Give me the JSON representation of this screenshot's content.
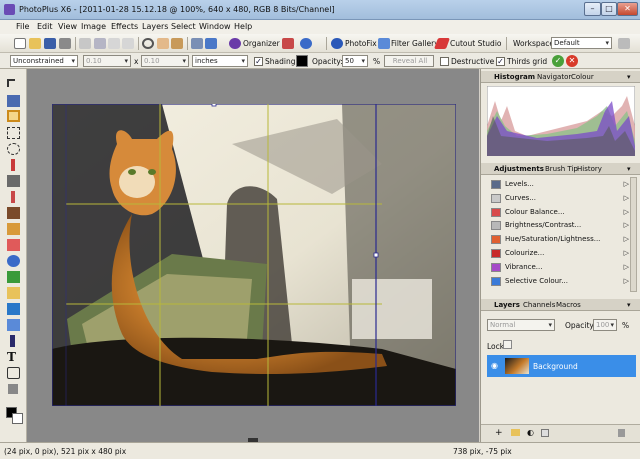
{
  "window": {
    "title": "PhotoPlus X6 - [2011-01-28 15.12.18 @ 100%, 640 x 480, RGB 8 Bits/Channel]",
    "buttons": [
      "–",
      "□",
      "✕"
    ]
  },
  "menu": [
    "File",
    "Edit",
    "View",
    "Image",
    "Effects",
    "Layers",
    "Select",
    "Window",
    "Help"
  ],
  "toolbar": {
    "organizer": "Organizer",
    "photofix": "PhotoFix",
    "filter_gallery": "Filter Gallery",
    "cutout_studio": "Cutout Studio",
    "workspace_label": "Workspace",
    "workspace_value": "Default"
  },
  "context_bar": {
    "crop_mode": "Unconstrained",
    "width": "0.10",
    "x_sep": "x",
    "height": "0.10",
    "units": "inches",
    "shading_label": "Shading",
    "shading_color": "#000000",
    "opacity_label": "Opacity:",
    "opacity_value": "50",
    "opacity_unit": "%",
    "reveal_all": "Reveal All",
    "destructive_label": "Destructive",
    "thirds_grid_label": "Thirds grid"
  },
  "panels": {
    "top_tabs": [
      "Histogram",
      "Navigator",
      "Colour"
    ],
    "adjust_tabs": [
      "Adjustments",
      "Brush Tip",
      "History"
    ],
    "adjustments": [
      {
        "label": "Levels...",
        "icon": "levels-icon",
        "color": "#5a6a8a"
      },
      {
        "label": "Curves...",
        "icon": "curves-icon",
        "color": "#c9c9c9"
      },
      {
        "label": "Colour Balance...",
        "icon": "colour-balance-icon",
        "color": "#d84b4b"
      },
      {
        "label": "Brightness/Contrast...",
        "icon": "brightness-contrast-icon",
        "color": "#b8b8b8"
      },
      {
        "label": "Hue/Saturation/Lightness...",
        "icon": "hue-saturation-icon",
        "color": "#e06030"
      },
      {
        "label": "Colourize...",
        "icon": "colourize-icon",
        "color": "#c82a2a"
      },
      {
        "label": "Vibrance...",
        "icon": "vibrance-icon",
        "color": "#a64bc8"
      },
      {
        "label": "Selective Colour...",
        "icon": "selective-colour-icon",
        "color": "#3a7ad8"
      }
    ],
    "layer_tabs": [
      "Layers",
      "Channels",
      "Macros"
    ],
    "blend_mode": "Normal",
    "opacity_label": "Opacity:",
    "opacity_value": "100",
    "opacity_unit": "%",
    "lock_label": "Lock:",
    "layer_name": "Background"
  },
  "status": {
    "left": "(24 pix, 0 pix), 521 pix x 480 pix",
    "right": "738 pix, -75 pix"
  }
}
